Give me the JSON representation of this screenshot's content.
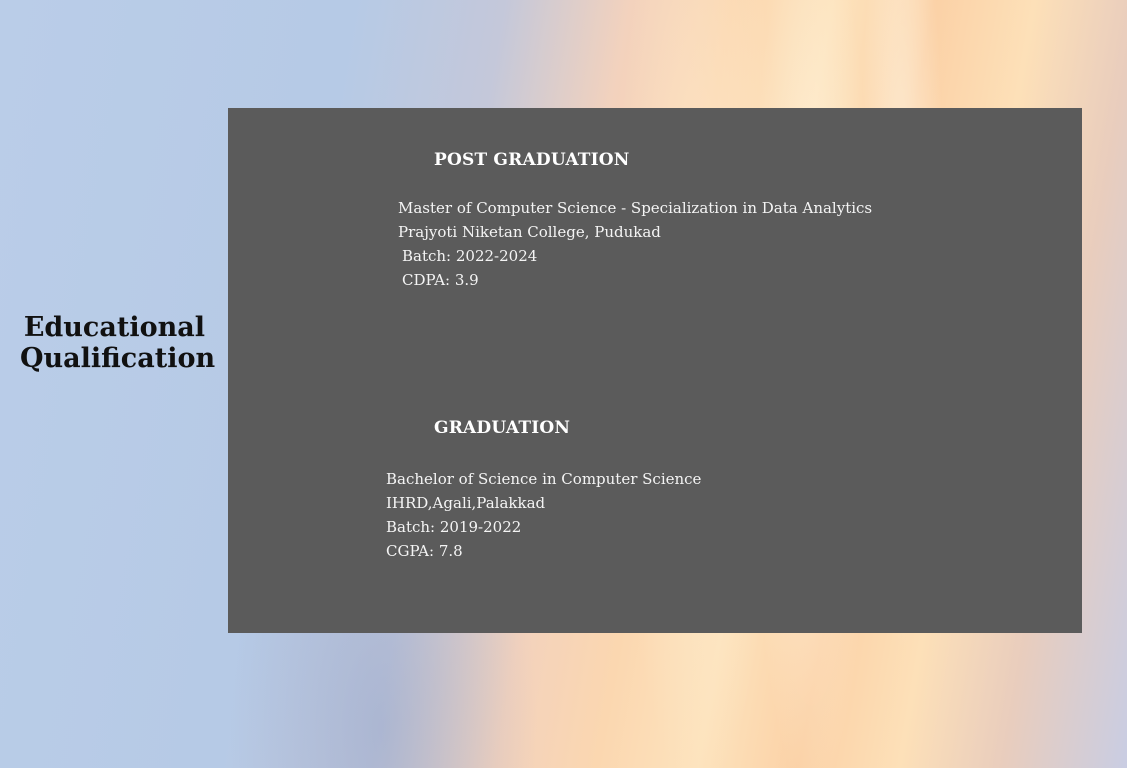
{
  "heading": {
    "line1": "Educational",
    "line2": "Qualification"
  },
  "post_graduation": {
    "title": "POST GRADUATION",
    "degree": "Master of Computer Science - Specialization in Data Analytics",
    "institution": "Prajyoti Niketan College, Pudukad",
    "batch": "Batch: 2022-2024",
    "score": "CDPA: 3.9"
  },
  "graduation": {
    "title": "GRADUATION",
    "degree": "Bachelor of Science in Computer Science",
    "institution": "IHRD,Agali,Palakkad",
    "batch": "Batch: 2019-2022",
    "score": "CGPA: 7.8"
  }
}
